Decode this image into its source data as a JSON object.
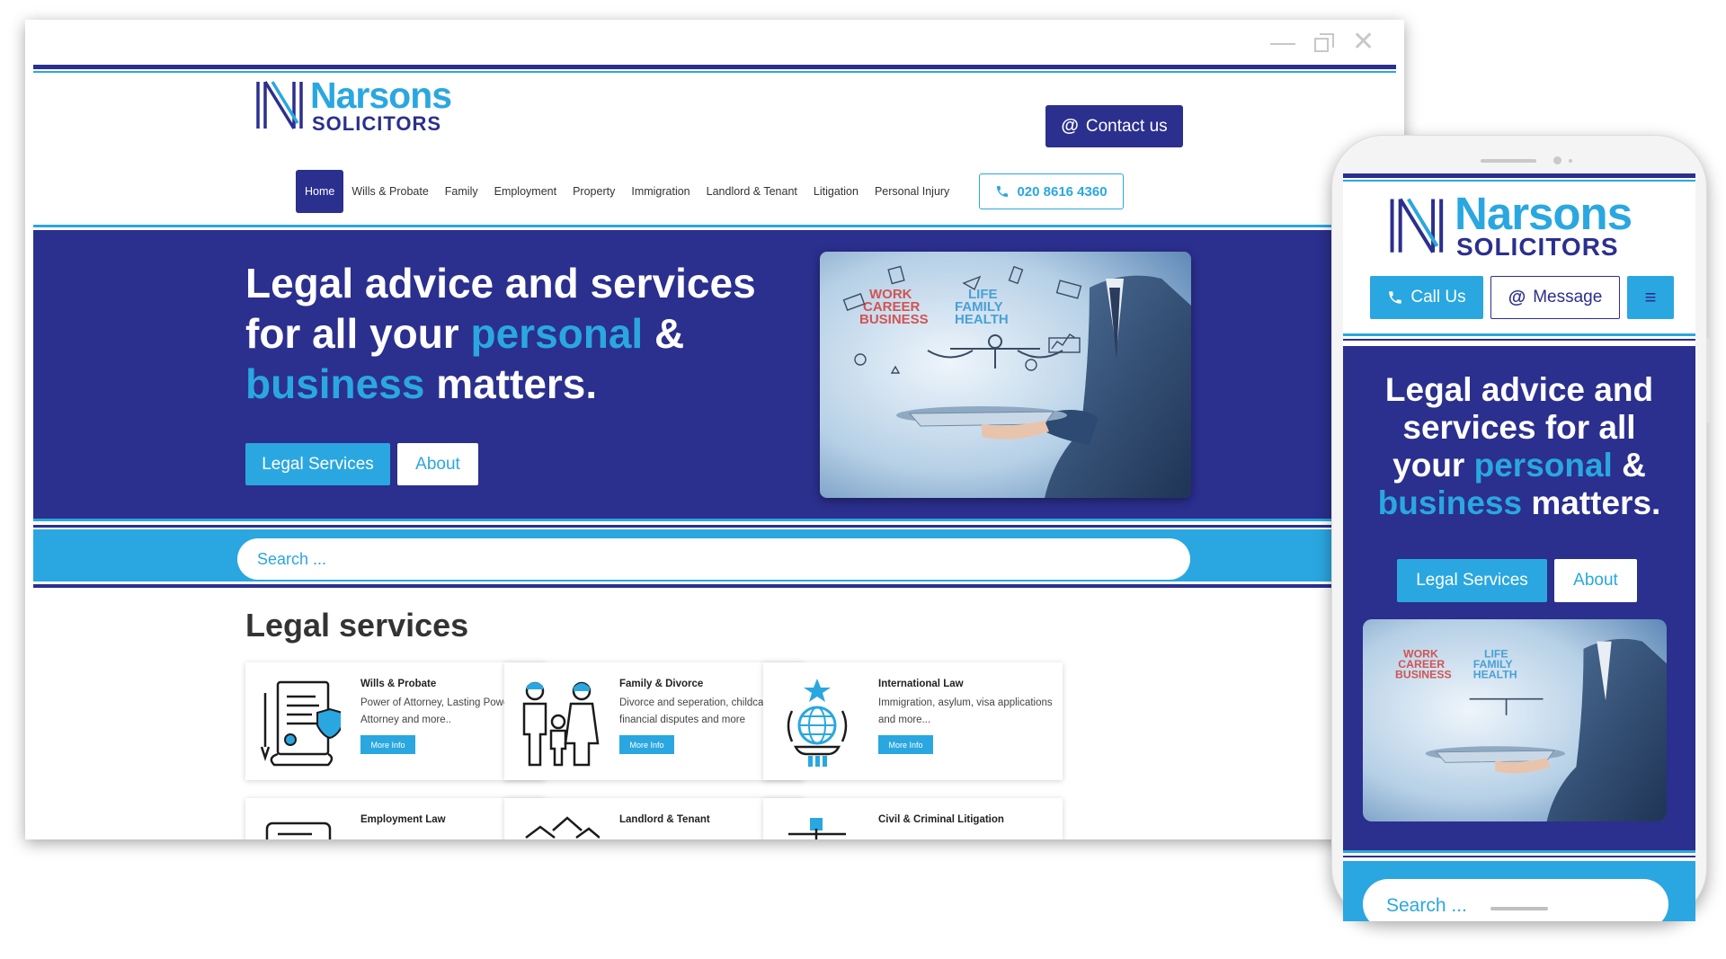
{
  "brand": {
    "name_line1": "Narsons",
    "name_line2": "SOLICITORS",
    "primary": "#2b2f8e",
    "accent": "#2aa7e0"
  },
  "window": {
    "controls": [
      "minimize-icon",
      "restore-icon",
      "close-icon"
    ]
  },
  "header": {
    "contact_label": "Contact us",
    "contact_icon": "@",
    "phone_number": "020 8616 4360"
  },
  "nav": {
    "items": [
      "Home",
      "Wills & Probate",
      "Family",
      "Employment",
      "Property",
      "Immigration",
      "Landlord & Tenant",
      "Litigation",
      "Personal Injury"
    ],
    "active": "Home"
  },
  "hero": {
    "line1": "Legal advice and services",
    "line2_a": "for all your ",
    "line2_hl": "personal",
    "line2_b": " &",
    "line3_hl": "business",
    "line3_b": " matters.",
    "btn_primary": "Legal Services",
    "btn_secondary": "About",
    "image_words_left": [
      "WORK",
      "CAREER",
      "BUSINESS"
    ],
    "image_words_right": [
      "LIFE",
      "FAMILY",
      "HEALTH"
    ]
  },
  "search": {
    "placeholder": "Search ..."
  },
  "services": {
    "title": "Legal services",
    "more_label": "More Info",
    "cards": [
      {
        "title": "Wills & Probate",
        "desc": "Power of Attorney, Lasting Power of Attorney and more..",
        "icon": "will-document-icon"
      },
      {
        "title": "Family & Divorce",
        "desc": "Divorce and seperation, childcare, financial disputes and more",
        "icon": "family-icon"
      },
      {
        "title": "International Law",
        "desc": "Immigration, asylum, visa applications and more...",
        "icon": "globe-pillar-icon"
      },
      {
        "title": "Employment Law",
        "icon": "contract-icon"
      },
      {
        "title": "Landlord & Tenant",
        "icon": "houses-icon"
      },
      {
        "title": "Civil & Criminal Litigation",
        "icon": "scales-icon"
      }
    ]
  },
  "mobile": {
    "call_label": "Call Us",
    "message_label": "Message",
    "menu_icon": "≡",
    "title_l1": "Legal advice and",
    "title_l2": "services for all",
    "title_l3a": "your ",
    "title_l3hl": "personal",
    "title_l3b": " &",
    "title_l4hl": "business",
    "title_l4b": " matters.",
    "btn_primary": "Legal Services",
    "btn_secondary": "About",
    "search_placeholder": "Search ..."
  }
}
